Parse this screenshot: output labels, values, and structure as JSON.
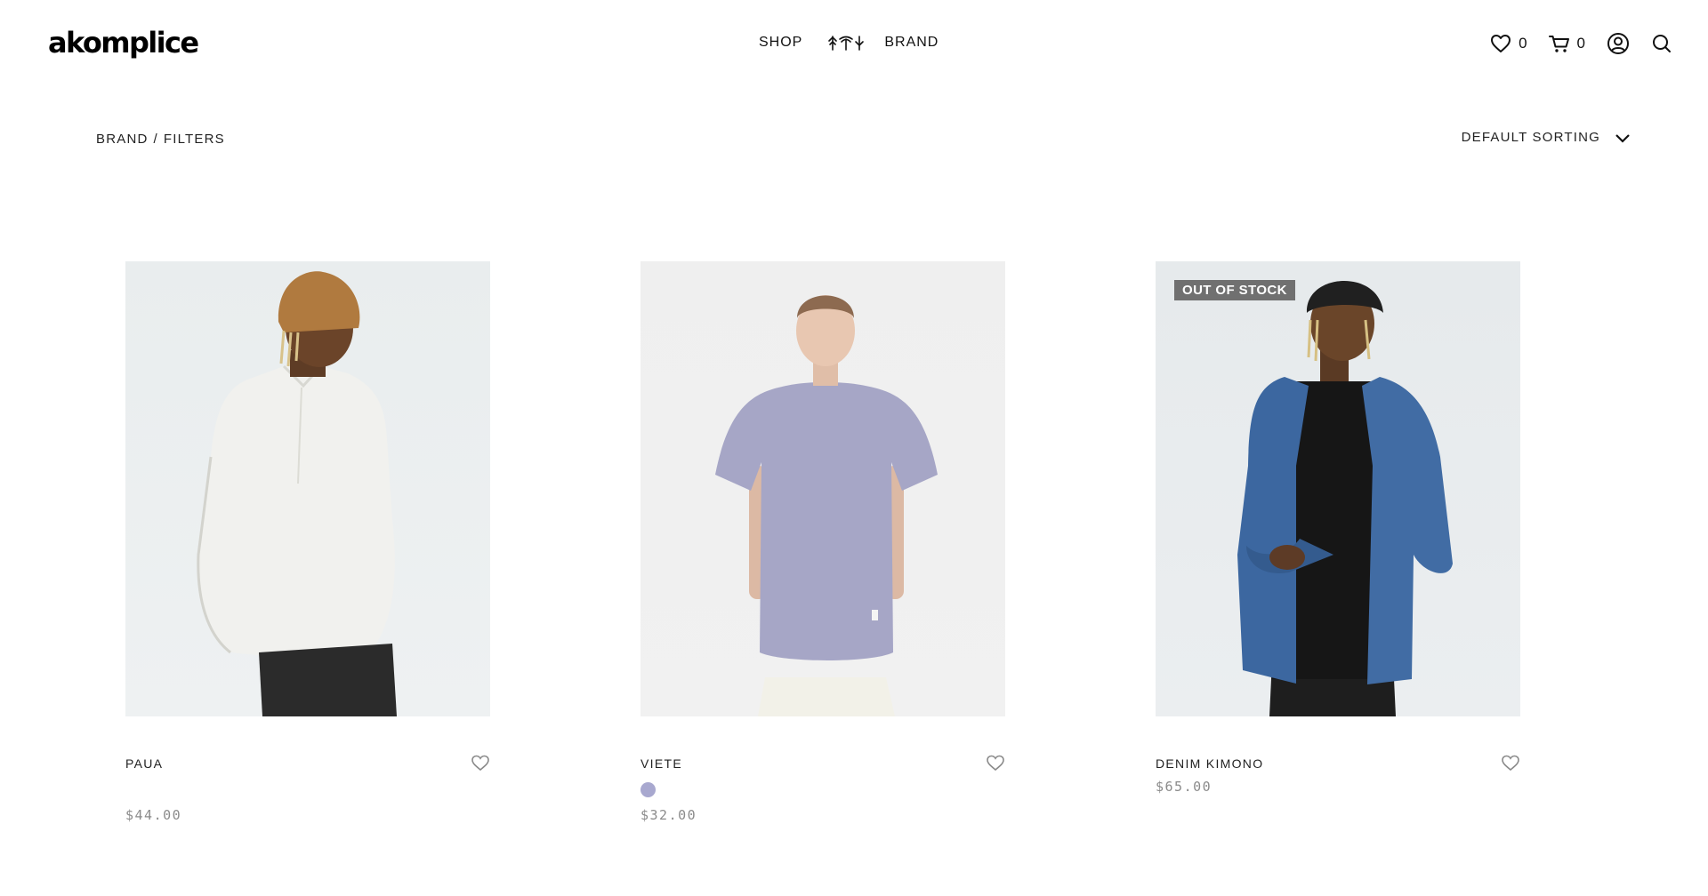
{
  "brand": {
    "logo": "akomplice"
  },
  "nav": {
    "shop": "SHOP",
    "brand": "BRAND",
    "mark_icon": "palm-trees-icon"
  },
  "header": {
    "wishlist_count": "0",
    "cart_count": "0"
  },
  "toolbar": {
    "breadcrumb": {
      "brand": "BRAND",
      "separator": "/",
      "filters": "FILTERS"
    },
    "sorting": "DEFAULT SORTING"
  },
  "products": [
    {
      "name": "PAUA",
      "price": "$44.00",
      "badge": "",
      "swatches": []
    },
    {
      "name": "VIETE",
      "price": "$32.00",
      "badge": "",
      "swatches": [
        "#a8a8cf"
      ]
    },
    {
      "name": "DENIM KIMONO",
      "price": "$65.00",
      "badge": "OUT OF STOCK",
      "swatches": []
    }
  ],
  "colors": {
    "badge_bg": "#707070",
    "price": "#8b8b8b",
    "swatch_lavender": "#a8a8cf"
  }
}
